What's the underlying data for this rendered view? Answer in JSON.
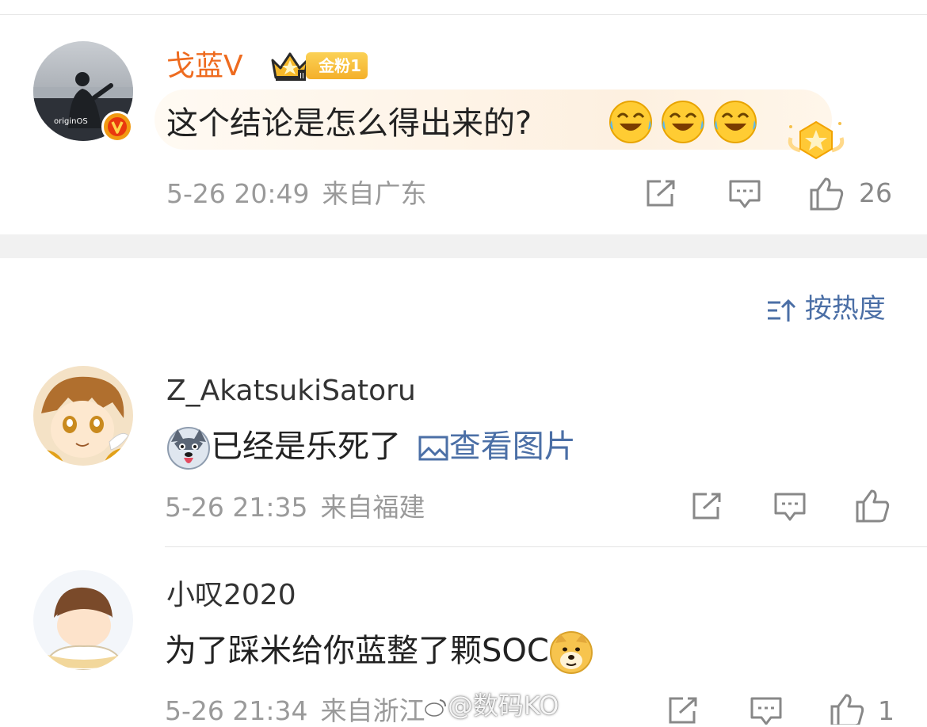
{
  "comments": [
    {
      "username": "戈蓝V",
      "fan_badge": "金粉1",
      "text": "这个结论是怎么得出来的?",
      "emojis": [
        "laugh-cry-emoji",
        "laugh-cry-emoji",
        "laugh-cry-emoji"
      ],
      "date": "5-26 20:49",
      "location": "来自广东",
      "like_count": "26",
      "name_color": "#ee6b1f"
    },
    {
      "username": "Z_AkatsukiSatoru",
      "emoji": "husky-emoji",
      "text": "已经是乐死了",
      "image_link": "查看图片",
      "date": "5-26 21:35",
      "location": "来自福建",
      "like_count": ""
    },
    {
      "username": "小叹2020",
      "text": "为了踩米给你蓝整了颗SOC",
      "emoji": "doge-emoji",
      "date": "5-26 21:34",
      "location": "来自浙江",
      "like_count": "1"
    }
  ],
  "sort": {
    "label": "按热度"
  },
  "watermark": "@数码KO",
  "colors": {
    "link": "#4b6fa6",
    "meta": "#9a9a9a",
    "gap": "#f1f1f1"
  }
}
